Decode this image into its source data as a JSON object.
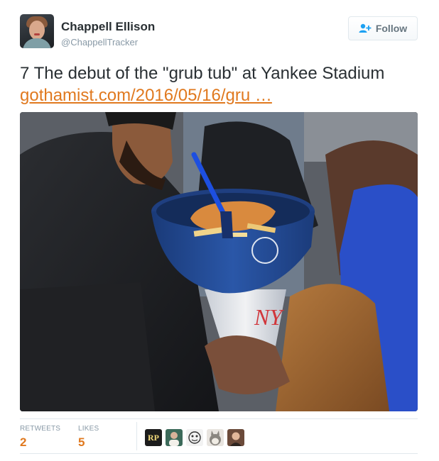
{
  "header": {
    "name": "Chappell Ellison",
    "handle": "@ChappellTracker",
    "follow_label": "Follow"
  },
  "tweet": {
    "text": "7 The debut of the \"grub tub\" at Yankee Stadium",
    "link": "gothamist.com/2016/05/16/gru …"
  },
  "stats": {
    "retweets_label": "RETWEETS",
    "retweets_count": "2",
    "likes_label": "LIKES",
    "likes_count": "5"
  },
  "likers": [
    {
      "icon": "rp-logo-avatar",
      "initials": "RP",
      "bg": "#1c1c1c"
    },
    {
      "icon": "person-avatar",
      "bg": "#3c6a5a"
    },
    {
      "icon": "cartoon-avatar",
      "bg": "#f2f2f2"
    },
    {
      "icon": "totoro-avatar",
      "bg": "#e8e4df"
    },
    {
      "icon": "person-avatar",
      "bg": "#6b4a3a"
    }
  ],
  "colors": {
    "link": "#e0791f",
    "text": "#292f33",
    "muted": "#8899a6",
    "follow_icon": "#1da1f2"
  }
}
